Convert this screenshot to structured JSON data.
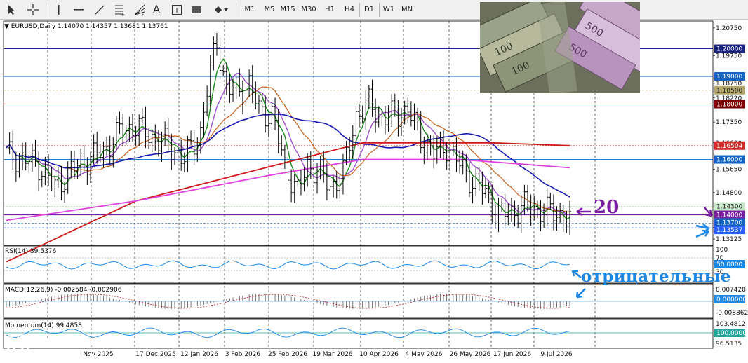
{
  "toolbar": {
    "tool_icons": [
      "cursor-icon",
      "crosshair-icon",
      "vertical-line-icon",
      "horizontal-line-icon",
      "trendline-icon",
      "fibonacci-icon",
      "fibonacci-fan-icon",
      "text-icon",
      "text-label-icon",
      "rectangle-icon",
      "shapes-dropdown-icon"
    ],
    "text_tool_label": "A",
    "timeframes": [
      "M1",
      "M5",
      "M15",
      "M30",
      "H1",
      "H4",
      "D1",
      "W1",
      "MN"
    ]
  },
  "chart": {
    "header": {
      "symbol": "EURUSD,Daily",
      "ohlc": "1.14070 1.14357 1.13681 1.13761"
    },
    "price_axis": [
      "1.20750",
      "1.19750",
      "1.18750",
      "1.18220",
      "1.17350",
      "1.16600",
      "1.15650",
      "1.14800",
      "1.13537",
      "1.13125"
    ],
    "price_labels": [
      {
        "value": "1.20000",
        "color": "#1a237e"
      },
      {
        "value": "1.19000",
        "color": "#1565c0"
      },
      {
        "value": "1.18500",
        "color": "#b5a86a"
      },
      {
        "value": "1.18000",
        "color": "#7f0000"
      },
      {
        "value": "1.16504",
        "color": "#d32f2f"
      },
      {
        "value": "1.16000",
        "color": "#1565c0"
      },
      {
        "value": "1.14300",
        "color": "#c8e6c9"
      },
      {
        "value": "1.14000",
        "color": "#7b1fa2"
      },
      {
        "value": "1.13700",
        "color": "#1565c0"
      },
      {
        "value": "1.13537",
        "color": "#2962ff"
      }
    ],
    "date_axis": [
      "Nov 2025",
      "17 Dec 2025",
      "12 Jan 2026",
      "3 Feb 2026",
      "25 Feb 2026",
      "19 Mar 2026",
      "10 Apr 2026",
      "4 May 2026",
      "26 May 2026",
      "17 Jun 2026",
      "9 Jul 2026"
    ],
    "colors": {
      "price": "#000000",
      "ma_green": "#1b8a1b",
      "ma_violet": "#9c4dcc",
      "ma_orange": "#c8601a",
      "ma_blue": "#1a1ab0",
      "ma_red": "#cc1a1a",
      "ma_magenta": "#e040e0",
      "accent_purple": "#7b1fa2",
      "accent_blue": "#1e88e5"
    }
  },
  "rsi": {
    "title": "RSI(14) 39.5376",
    "axis": [
      "100",
      "70",
      "30",
      "0"
    ],
    "current_label": "50.0000"
  },
  "macd": {
    "title": "MACD(12,26,9) -0.002584 -0.002906",
    "axis": [
      "0.007428",
      "-0.008862"
    ],
    "current_label": "0.000000"
  },
  "momentum": {
    "title": "Momentum(14) 99.4858",
    "axis": [
      "103.4812",
      "96.5135"
    ],
    "current_label": "100.0000"
  },
  "annotations": {
    "ma_label": "20",
    "indicator_note": "отрицательные"
  },
  "logo": {
    "name": "instaforex",
    "tagline": "Instant Forex Trading"
  }
}
